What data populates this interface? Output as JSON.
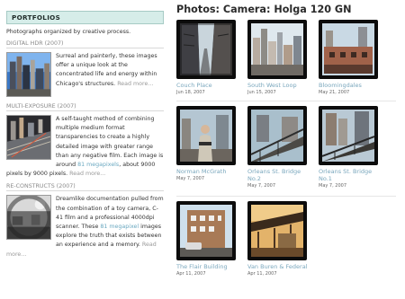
{
  "sidebar": {
    "header": "PORTFOLIOS",
    "intro": "Photographs organized by creative process.",
    "sections": [
      {
        "title": "DIGITAL HDR (2007)",
        "text": "Surreal and painterly, these images offer a unique look at the concentrated life and energy within Chicago's structures.",
        "more": "Read more..."
      },
      {
        "title": "MULTI-EXPOSURE (2007)",
        "text_before": "A self-taught method of combining multiple medium format transparencies to create a highly detailed image with greater range than any negative film. Each image is around ",
        "highlight": "81 megapixels",
        "text_after": ", about 9000 pixels by 9000 pixels.",
        "more": "Read more..."
      },
      {
        "title": "RE-CONSTRUCTS (2007)",
        "text_before": "Dreamlike documentation pulled from the combination of a toy camera, C-41 film and a professional 4000dpi scanner. These ",
        "highlight": "81 megapixel",
        "text_after": " images explore the truth that exists between an experience and a memory.",
        "more": "Read more..."
      }
    ]
  },
  "main": {
    "title": "Photos: Camera: Holga 120 GN",
    "photos": [
      {
        "caption": "Couch Place",
        "date": "Jun 18, 2007"
      },
      {
        "caption": "South West Loop",
        "date": "Jun 15, 2007"
      },
      {
        "caption": "Bloomingdales",
        "date": "May 21, 2007"
      },
      {
        "caption": "Norman McGrath",
        "date": "May 7, 2007"
      },
      {
        "caption": "Orleans St. Bridge No.2",
        "date": "May 7, 2007"
      },
      {
        "caption": "Orleans St. Bridge No.1",
        "date": "May 7, 2007"
      },
      {
        "caption": "The Flair Building",
        "date": "Apr 11, 2007"
      },
      {
        "caption": "Van Buren & Federal",
        "date": "Apr 11, 2007"
      }
    ]
  },
  "colors": {
    "header_bg": "#d6ede9",
    "link": "#7aa7bd",
    "highlight": "#6aa8c0",
    "frame": "#0c0c0c"
  }
}
